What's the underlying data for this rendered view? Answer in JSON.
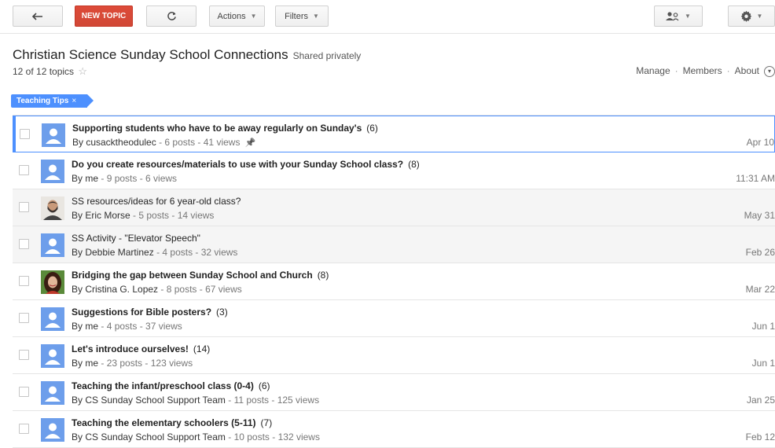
{
  "toolbar": {
    "back_icon": "arrow-left-icon",
    "new_topic_label": "NEW TOPIC",
    "refresh_icon": "refresh-icon",
    "actions_label": "Actions",
    "filters_label": "Filters",
    "members_icon": "person-add-icon",
    "settings_icon": "gear-icon"
  },
  "header": {
    "title": "Christian Science Sunday School Connections",
    "shared": "Shared privately",
    "topic_count": "12 of 12 topics",
    "links": [
      "Manage",
      "Members",
      "About"
    ]
  },
  "filter_tag": {
    "label": "Teaching Tips",
    "close": "×"
  },
  "topics": [
    {
      "title": "Supporting students who have to be away regularly on Sunday's",
      "count": "(6)",
      "author": "By cusacktheodulec",
      "stats": "- 6 posts - 41 views",
      "date": "Apr 10",
      "avatar": "default",
      "unread": true,
      "pinned": true
    },
    {
      "title": "Do you create resources/materials to use with your Sunday School class?",
      "count": "(8)",
      "author": "By me",
      "stats": "- 9 posts - 6 views",
      "date": "11:31 AM",
      "avatar": "default",
      "unread": true
    },
    {
      "title": "SS resources/ideas for 6 year-old class?",
      "count": "",
      "author": "By Eric Morse",
      "stats": "- 5 posts - 14 views",
      "date": "May 31",
      "avatar": "man",
      "unread": false
    },
    {
      "title": "SS Activity - \"Elevator Speech\"",
      "count": "",
      "author": "By Debbie Martinez",
      "stats": "- 4 posts - 32 views",
      "date": "Feb 26",
      "avatar": "default",
      "unread": false
    },
    {
      "title": "Bridging the gap between Sunday School and Church",
      "count": "(8)",
      "author": "By Cristina G. Lopez",
      "stats": "- 8 posts - 67 views",
      "date": "Mar 22",
      "avatar": "woman",
      "unread": true
    },
    {
      "title": "Suggestions for Bible posters?",
      "count": "(3)",
      "author": "By me",
      "stats": "- 4 posts - 37 views",
      "date": "Jun 1",
      "avatar": "default",
      "unread": true
    },
    {
      "title": "Let's introduce ourselves!",
      "count": "(14)",
      "author": "By me",
      "stats": "- 23 posts - 123 views",
      "date": "Jun 1",
      "avatar": "default",
      "unread": true
    },
    {
      "title": "Teaching the infant/preschool class (0-4)",
      "count": "(6)",
      "author": "By CS Sunday School Support Team",
      "stats": "- 11 posts - 125 views",
      "date": "Jan 25",
      "avatar": "default",
      "unread": true
    },
    {
      "title": "Teaching the elementary schoolers (5-11)",
      "count": "(7)",
      "author": "By CS Sunday School Support Team",
      "stats": "- 10 posts - 132 views",
      "date": "Feb 12",
      "avatar": "default",
      "unread": true
    }
  ]
}
